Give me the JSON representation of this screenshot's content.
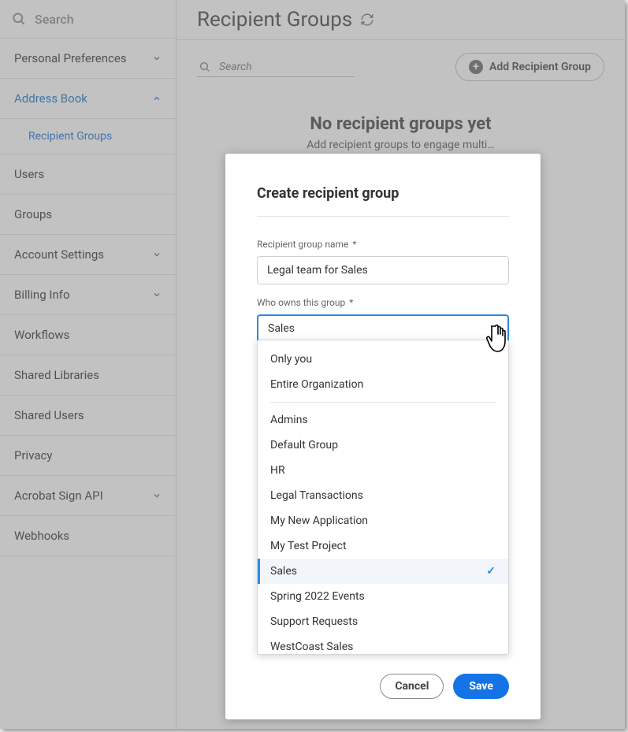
{
  "sidebar": {
    "search_placeholder": "Search",
    "items": [
      {
        "label": "Personal Preferences",
        "expandable": true,
        "expanded": false
      },
      {
        "label": "Address Book",
        "expandable": true,
        "expanded": true,
        "active": true,
        "sub": [
          {
            "label": "Recipient Groups"
          }
        ]
      },
      {
        "label": "Users"
      },
      {
        "label": "Groups"
      },
      {
        "label": "Account Settings",
        "expandable": true,
        "expanded": false
      },
      {
        "label": "Billing Info",
        "expandable": true,
        "expanded": false
      },
      {
        "label": "Workflows"
      },
      {
        "label": "Shared Libraries"
      },
      {
        "label": "Shared Users"
      },
      {
        "label": "Privacy"
      },
      {
        "label": "Acrobat Sign API",
        "expandable": true,
        "expanded": false
      },
      {
        "label": "Webhooks"
      }
    ]
  },
  "page": {
    "title": "Recipient Groups",
    "search_placeholder": "Search",
    "add_button": "Add Recipient Group",
    "empty_title": "No recipient groups yet",
    "empty_sub": "Add recipient groups to engage multi…"
  },
  "modal": {
    "title": "Create recipient group",
    "name_label": "Recipient group name",
    "name_value": "Legal team for Sales",
    "owner_label": "Who owns this group",
    "owner_selected": "Sales",
    "options_top": [
      "Only you",
      "Entire Organization"
    ],
    "options": [
      "Admins",
      "Default Group",
      "HR",
      "Legal Transactions",
      "My New Application",
      "My Test Project",
      "Sales",
      "Spring 2022 Events",
      "Support Requests",
      "WestCoast Sales"
    ],
    "cancel": "Cancel",
    "save": "Save"
  }
}
